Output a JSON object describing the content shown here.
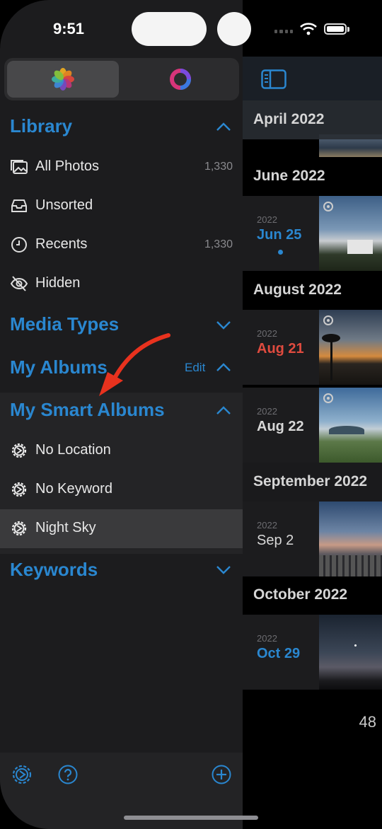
{
  "status_bar": {
    "time": "9:51"
  },
  "sidebar": {
    "sections": {
      "library": "Library",
      "media_types": "Media Types",
      "my_albums": "My Albums",
      "my_albums_edit": "Edit",
      "my_smart_albums": "My Smart Albums",
      "keywords": "Keywords"
    },
    "library_items": [
      {
        "label": "All Photos",
        "count": "1,330",
        "icon": "photo-stack-icon"
      },
      {
        "label": "Unsorted",
        "count": "",
        "icon": "tray-icon"
      },
      {
        "label": "Recents",
        "count": "1,330",
        "icon": "clock-icon"
      },
      {
        "label": "Hidden",
        "count": "",
        "icon": "eye-slash-icon"
      }
    ],
    "smart_albums": [
      {
        "label": "No Location",
        "icon": "gear-icon"
      },
      {
        "label": "No Keyword",
        "icon": "gear-icon"
      },
      {
        "label": "Night Sky",
        "icon": "gear-icon",
        "selected": true
      }
    ]
  },
  "timeline": {
    "sections": [
      {
        "month": "April 2022"
      },
      {
        "month": "June 2022",
        "year": "2022",
        "day": "Jun 25",
        "day_color": "#2a87d0",
        "has_dot": true
      },
      {
        "month": "August 2022",
        "year": "2022",
        "day": "Aug 21",
        "day_color": "#e04b3f"
      },
      {
        "month": "",
        "year": "2022",
        "day": "Aug 22",
        "day_color": "#d8d8d8"
      },
      {
        "month": "September 2022",
        "year": "2022",
        "day": "Sep 2",
        "day_color": "#d8d8d8"
      },
      {
        "month": "October 2022",
        "year": "2022",
        "day": "Oct 29",
        "day_color": "#2a87d0"
      }
    ],
    "total_count": "48"
  },
  "colors": {
    "accent": "#2a87d0",
    "annotation_arrow": "#e8321e"
  }
}
